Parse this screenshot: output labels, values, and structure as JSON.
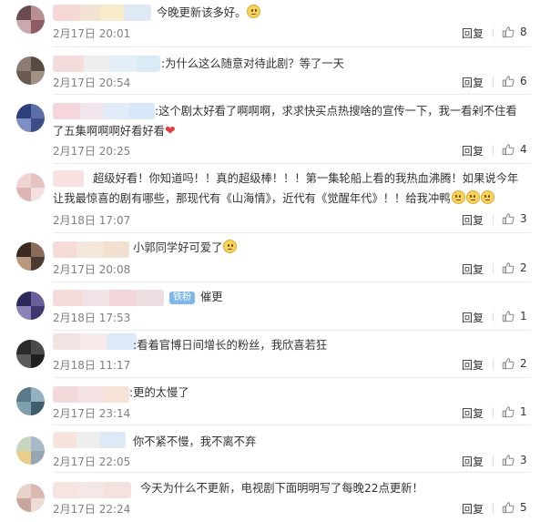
{
  "reply_label": "回复",
  "colors": {
    "time": "#808080",
    "text": "#333333",
    "badge": "#7fb7e9",
    "heart": "#e23b3b"
  },
  "comments": [
    {
      "text": "今晚更新该多好。",
      "emoji": "smile-emoji",
      "time": "2月17日 20:01",
      "likes": "8"
    },
    {
      "text": ":为什么这么随意对待此剧？等了一天",
      "time": "2月17日 20:54",
      "likes": "6"
    },
    {
      "text": ":这个剧太好看了啊啊啊，求求快买点热搜啥的宣传一下，我一看剁不住看了五集啊啊啊好看好看",
      "emoji": "red-heart-emoji",
      "time": "2月17日 20:25",
      "likes": "4"
    },
    {
      "text": "超级好看！你知道吗！！真的超级棒！！！第一集轮船上看的我热血沸腾！如果说今年让我最惊喜的剧有哪些，那现代有《山海情》，近代有《觉醒年代》！！给我冲鸭",
      "emoji": "smile-emoji",
      "time": "2月18日 17:07",
      "likes": "3"
    },
    {
      "text": "小郭同学好可爱了",
      "emoji": "smile-emoji",
      "time": "2月17日 20:08",
      "likes": "2"
    },
    {
      "badge": "铁粉",
      "text": "催更",
      "time": "2月18日 17:53",
      "likes": "1"
    },
    {
      "text": ":看着官博日间增长的粉丝，我欣喜若狂",
      "time": "2月18日 11:17",
      "likes": "2"
    },
    {
      "text": ":更的太慢了",
      "time": "2月17日 23:14",
      "likes": "1"
    },
    {
      "text": "你不紧不慢，我不离不弃",
      "time": "2月17日 22:05",
      "likes": "3"
    },
    {
      "text": "今天为什么不更新，电视剧下面明明写了每晚22点更新！",
      "time": "2月17日 22:24",
      "likes": "5"
    }
  ]
}
